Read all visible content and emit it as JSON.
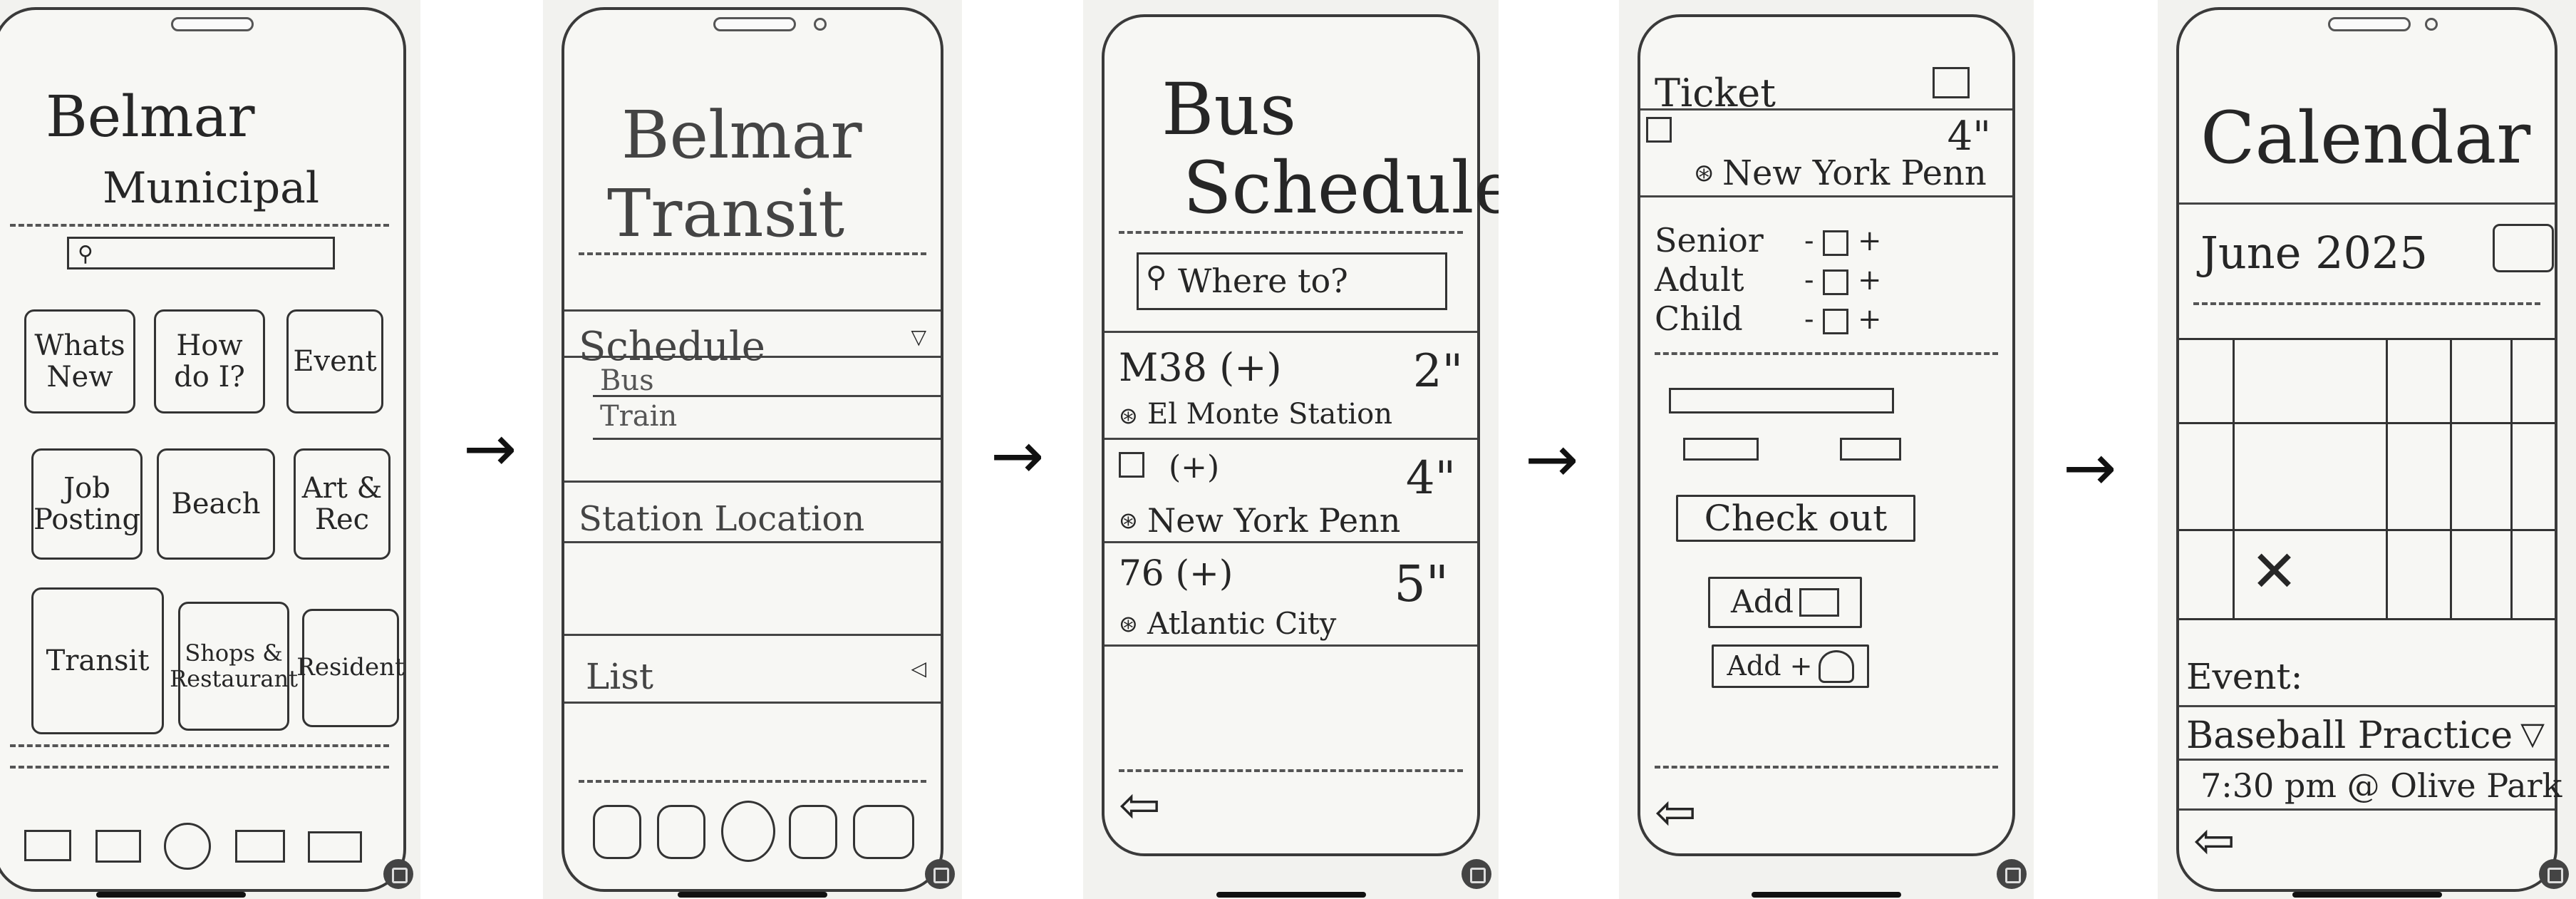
{
  "screens": [
    {
      "title_line1": "Belmar",
      "title_line2": "Municipal",
      "tiles": [
        {
          "label": "Whats New"
        },
        {
          "label": "How do I?"
        },
        {
          "label": "Event"
        },
        {
          "label": "Job Posting"
        },
        {
          "label": "Beach"
        },
        {
          "label": "Art & Rec"
        },
        {
          "label": "Transit"
        },
        {
          "label": "Shops & Restaurant"
        },
        {
          "label": "Resident"
        }
      ]
    },
    {
      "title_line1": "Belmar",
      "title_line2": "Transit",
      "schedule_label": "Schedule",
      "schedule_options": [
        "Bus",
        "Train"
      ],
      "station_label": "Station Location",
      "list_label": "List"
    },
    {
      "title_line1": "Bus",
      "title_line2": "Schedule",
      "search_placeholder": "Where to?",
      "routes": [
        {
          "route": "M38 (+)",
          "time": "2\"",
          "destination": "El Monte Station"
        },
        {
          "route": "(+)",
          "time": "4\"",
          "destination": "New York Penn"
        },
        {
          "route": "76 (+)",
          "time": "5\"",
          "destination": "Atlantic City"
        }
      ]
    },
    {
      "header_label": "Ticket",
      "ticket_time": "4\"",
      "ticket_destination": "New York Penn",
      "passengers": [
        {
          "label": "Senior"
        },
        {
          "label": "Adult"
        },
        {
          "label": "Child"
        }
      ],
      "checkout_label": "Check out",
      "add_calendar_label": "Add",
      "add_person_label": "Add +"
    },
    {
      "title": "Calendar",
      "month": "June 2025",
      "event_label": "Event:",
      "event_name": "Baseball Practice",
      "event_time": "7:30 pm @ Olive Park"
    }
  ]
}
